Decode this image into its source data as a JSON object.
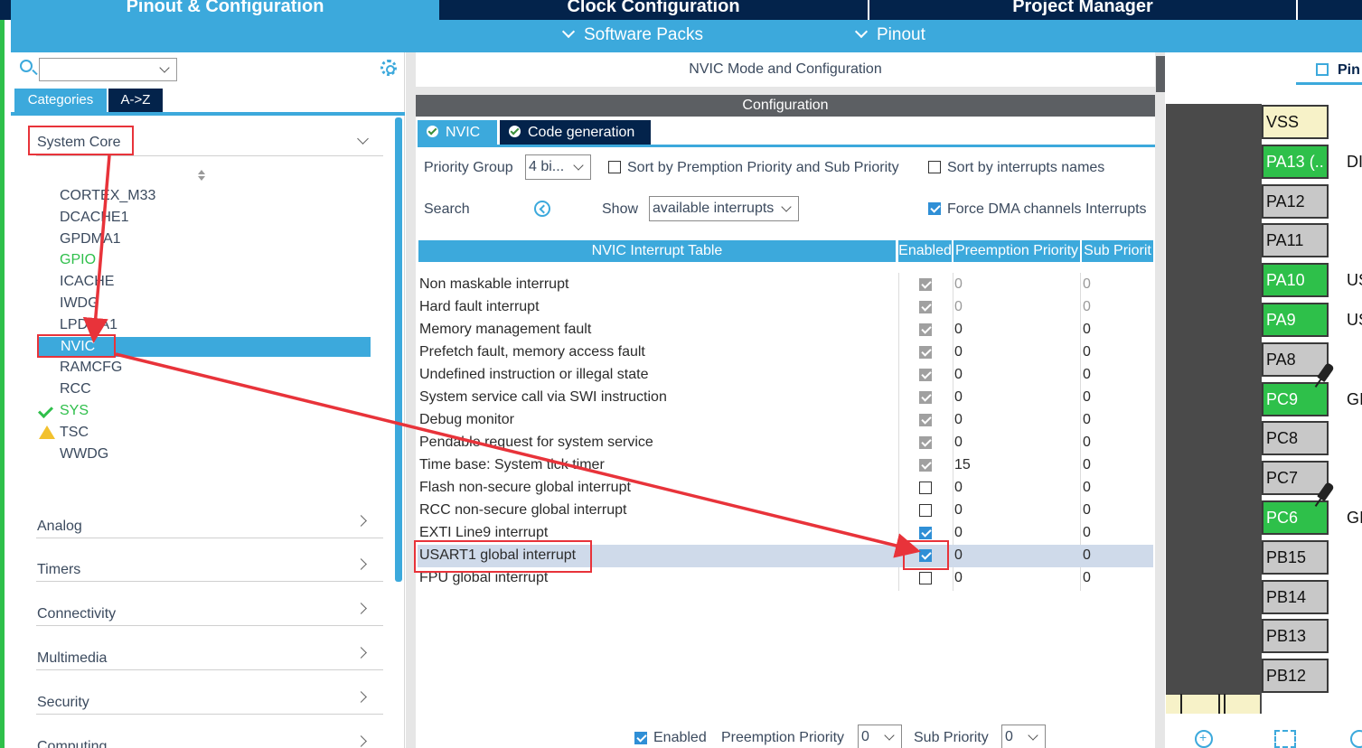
{
  "top_tabs": [
    "Pinout & Configuration",
    "Clock Configuration",
    "Project Manager"
  ],
  "subnav": [
    "Software Packs",
    "Pinout"
  ],
  "left": {
    "category_tabs": [
      "Categories",
      "A->Z"
    ],
    "system_core": "System Core",
    "peripherals": [
      {
        "label": "CORTEX_M33",
        "state": "normal"
      },
      {
        "label": "DCACHE1",
        "state": "normal"
      },
      {
        "label": "GPDMA1",
        "state": "normal"
      },
      {
        "label": "GPIO",
        "state": "green"
      },
      {
        "label": "ICACHE",
        "state": "normal"
      },
      {
        "label": "IWDG",
        "state": "normal"
      },
      {
        "label": "LPDMA1",
        "state": "normal"
      },
      {
        "label": "NVIC",
        "state": "selected"
      },
      {
        "label": "RAMCFG",
        "state": "normal"
      },
      {
        "label": "RCC",
        "state": "normal"
      },
      {
        "label": "SYS",
        "state": "check"
      },
      {
        "label": "TSC",
        "state": "warning"
      },
      {
        "label": "WWDG",
        "state": "normal"
      }
    ],
    "categories": [
      "Analog",
      "Timers",
      "Connectivity",
      "Multimedia",
      "Security",
      "Computing"
    ]
  },
  "center": {
    "title": "NVIC Mode and Configuration",
    "config_bar": "Configuration",
    "tabs": [
      "NVIC",
      "Code generation"
    ],
    "priority_group_label": "Priority Group",
    "priority_group_value": "4 bi...",
    "sort_preemption_label": "Sort by Premption Priority and Sub Priority",
    "sort_names_label": "Sort by interrupts names",
    "search_label": "Search",
    "show_label": "Show",
    "show_value": "available interrupts",
    "force_dma_label": "Force DMA channels Interrupts",
    "table_headers": [
      "NVIC Interrupt Table",
      "Enabled",
      "Preemption Priority",
      "Sub Priorit"
    ],
    "rows": [
      {
        "name": "Non maskable interrupt",
        "enabled": true,
        "locked": true,
        "pp": "0",
        "sp": "0",
        "readonly": true
      },
      {
        "name": "Hard fault interrupt",
        "enabled": true,
        "locked": true,
        "pp": "0",
        "sp": "0",
        "readonly": true
      },
      {
        "name": "Memory management fault",
        "enabled": true,
        "locked": true,
        "pp": "0",
        "sp": "0",
        "readonly": false
      },
      {
        "name": "Prefetch fault, memory access fault",
        "enabled": true,
        "locked": true,
        "pp": "0",
        "sp": "0",
        "readonly": false
      },
      {
        "name": "Undefined instruction or illegal state",
        "enabled": true,
        "locked": true,
        "pp": "0",
        "sp": "0",
        "readonly": false
      },
      {
        "name": "System service call via SWI instruction",
        "enabled": true,
        "locked": true,
        "pp": "0",
        "sp": "0",
        "readonly": false
      },
      {
        "name": "Debug monitor",
        "enabled": true,
        "locked": true,
        "pp": "0",
        "sp": "0",
        "readonly": false
      },
      {
        "name": "Pendable request for system service",
        "enabled": true,
        "locked": true,
        "pp": "0",
        "sp": "0",
        "readonly": false
      },
      {
        "name": "Time base: System tick timer",
        "enabled": true,
        "locked": true,
        "pp": "15",
        "sp": "0",
        "readonly": false
      },
      {
        "name": "Flash non-secure global interrupt",
        "enabled": false,
        "locked": false,
        "pp": "0",
        "sp": "0",
        "readonly": false
      },
      {
        "name": "RCC non-secure global interrupt",
        "enabled": false,
        "locked": false,
        "pp": "0",
        "sp": "0",
        "readonly": false
      },
      {
        "name": "EXTI Line9 interrupt",
        "enabled": true,
        "locked": false,
        "pp": "0",
        "sp": "0",
        "readonly": false
      },
      {
        "name": "USART1 global interrupt",
        "enabled": true,
        "locked": false,
        "pp": "0",
        "sp": "0",
        "readonly": false,
        "highlight": true
      },
      {
        "name": "FPU global interrupt",
        "enabled": false,
        "locked": false,
        "pp": "0",
        "sp": "0",
        "readonly": false
      }
    ],
    "bottom": {
      "enabled_label": "Enabled",
      "pp_label": "Preemption Priority",
      "pp_value": "0",
      "sp_label": "Sub Priority",
      "sp_value": "0"
    }
  },
  "right": {
    "tab_label": "Pin",
    "pins": [
      {
        "label": "VSS",
        "color": "yellow",
        "side": ""
      },
      {
        "label": "PA13 (..",
        "color": "green",
        "side": "DI"
      },
      {
        "label": "PA12",
        "color": "gray",
        "side": ""
      },
      {
        "label": "PA11",
        "color": "gray",
        "side": ""
      },
      {
        "label": "PA10",
        "color": "green",
        "side": "US"
      },
      {
        "label": "PA9",
        "color": "green",
        "side": "US"
      },
      {
        "label": "PA8",
        "color": "gray",
        "side": ""
      },
      {
        "label": "PC9",
        "color": "green",
        "side": "GI"
      },
      {
        "label": "PC8",
        "color": "gray",
        "side": ""
      },
      {
        "label": "PC7",
        "color": "gray",
        "side": ""
      },
      {
        "label": "PC6",
        "color": "green",
        "side": "GI"
      },
      {
        "label": "PB15",
        "color": "gray",
        "side": ""
      },
      {
        "label": "PB14",
        "color": "gray",
        "side": ""
      },
      {
        "label": "PB13",
        "color": "gray",
        "side": ""
      },
      {
        "label": "PB12",
        "color": "gray",
        "side": ""
      }
    ]
  },
  "colors": {
    "accent": "#3ca9dc",
    "navy": "#03234b",
    "pin_green": "#2ec04a",
    "annotation_red": "#e8333a"
  }
}
